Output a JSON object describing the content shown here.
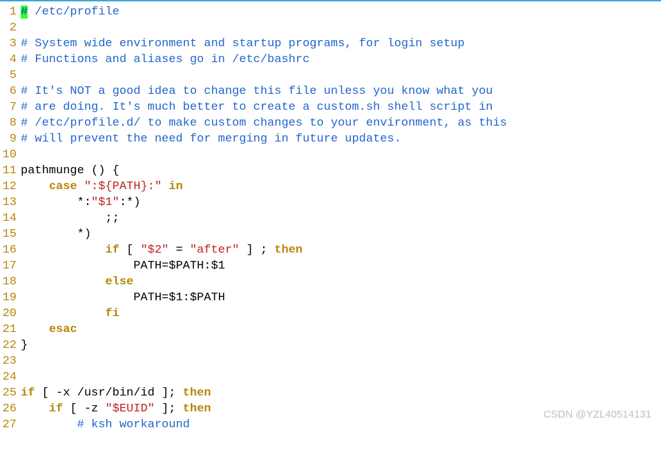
{
  "watermark": "CSDN @YZL40514131",
  "gutter": [
    "1",
    "2",
    "3",
    "4",
    "5",
    "6",
    "7",
    "8",
    "9",
    "10",
    "11",
    "12",
    "13",
    "14",
    "15",
    "16",
    "17",
    "18",
    "19",
    "20",
    "21",
    "22",
    "23",
    "24",
    "25",
    "26",
    "27"
  ],
  "lines": {
    "l1a": "#",
    "l1b": " /etc/profile",
    "l3": "# System wide environment and startup programs, for login setup",
    "l4": "# Functions and aliases go in /etc/bashrc",
    "l6": "# It's NOT a good idea to change this file unless you know what you",
    "l7": "# are doing. It's much better to create a custom.sh shell script in",
    "l8": "# /etc/profile.d/ to make custom changes to your environment, as this",
    "l9": "# will prevent the need for merging in future updates.",
    "l11a": "pathmunge",
    "l11b": " () {",
    "l12a": "    ",
    "l12b": "case",
    "l12c": " ",
    "l12d": "\":${PATH}:\"",
    "l12e": " ",
    "l12f": "in",
    "l13a": "        *:",
    "l13b": "\"$1\"",
    "l13c": ":*)",
    "l14": "            ;;",
    "l15": "        *)",
    "l16a": "            ",
    "l16b": "if",
    "l16c": " [ ",
    "l16d": "\"$2\"",
    "l16e": " = ",
    "l16f": "\"after\"",
    "l16g": " ] ; ",
    "l16h": "then",
    "l17a": "                ",
    "l17b": "PATH",
    "l17c": "=$PATH:$1",
    "l18a": "            ",
    "l18b": "else",
    "l19a": "                ",
    "l19b": "PATH",
    "l19c": "=$1:$PATH",
    "l20a": "            ",
    "l20b": "fi",
    "l21a": "    ",
    "l21b": "esac",
    "l22": "}",
    "l25a": "if",
    "l25b": " [ -x /usr/bin/id ]; ",
    "l25c": "then",
    "l26a": "    ",
    "l26b": "if",
    "l26c": " [ -z ",
    "l26d": "\"$EUID\"",
    "l26e": " ]; ",
    "l26f": "then",
    "l27a": "        ",
    "l27b": "# ksh workaround"
  }
}
